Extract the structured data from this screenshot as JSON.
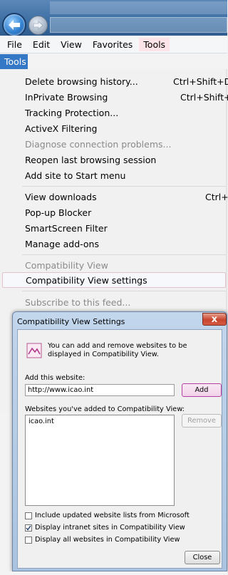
{
  "menubar": {
    "items": [
      "File",
      "Edit",
      "View",
      "Favorites",
      "Tools"
    ]
  },
  "tools_header": "Tools",
  "menu": {
    "items": [
      {
        "label": "Delete browsing history...",
        "shortcut": "Ctrl+Shift+De"
      },
      {
        "label": "InPrivate Browsing",
        "shortcut": "Ctrl+Shift+P"
      },
      {
        "label": "Tracking Protection...",
        "shortcut": ""
      },
      {
        "label": "ActiveX Filtering",
        "shortcut": ""
      },
      {
        "label": "Diagnose connection problems...",
        "shortcut": ""
      },
      {
        "label": "Reopen last browsing session",
        "shortcut": ""
      },
      {
        "label": "Add site to Start menu",
        "shortcut": ""
      },
      {
        "label": "View downloads",
        "shortcut": "Ctrl+J"
      },
      {
        "label": "Pop-up Blocker",
        "shortcut": ""
      },
      {
        "label": "SmartScreen Filter",
        "shortcut": ""
      },
      {
        "label": "Manage add-ons",
        "shortcut": ""
      },
      {
        "label": "Compatibility View",
        "shortcut": ""
      },
      {
        "label": "Compatibility View settings",
        "shortcut": ""
      },
      {
        "label": "Subscribe to this feed...",
        "shortcut": ""
      }
    ]
  },
  "dialog": {
    "title": "Compatibility View Settings",
    "close_label": "x",
    "info_text": "You can add and remove websites to be displayed in Compatibility View.",
    "add_label": "Add this website:",
    "add_value": "http://www.icao.int",
    "add_button": "Add",
    "list_label": "Websites you've added to Compatibility View:",
    "list_items": [
      "icao.int"
    ],
    "remove_button": "Remove",
    "options": [
      {
        "label": "Include updated website lists from Microsoft",
        "checked": false
      },
      {
        "label": "Display intranet sites in Compatibility View",
        "checked": true
      },
      {
        "label": "Display all websites in Compatibility View",
        "checked": false
      }
    ],
    "close_button": "Close"
  },
  "colors": {
    "menu_highlight": "#3478c6",
    "hover_border": "#e2c3c9",
    "add_button_border": "#b43fa0",
    "close_button_red": "#c7452d"
  },
  "icons": {
    "back": "back-arrow-icon",
    "forward": "forward-arrow-icon",
    "info": "compatibility-view-icon",
    "check": "checkmark-icon"
  }
}
